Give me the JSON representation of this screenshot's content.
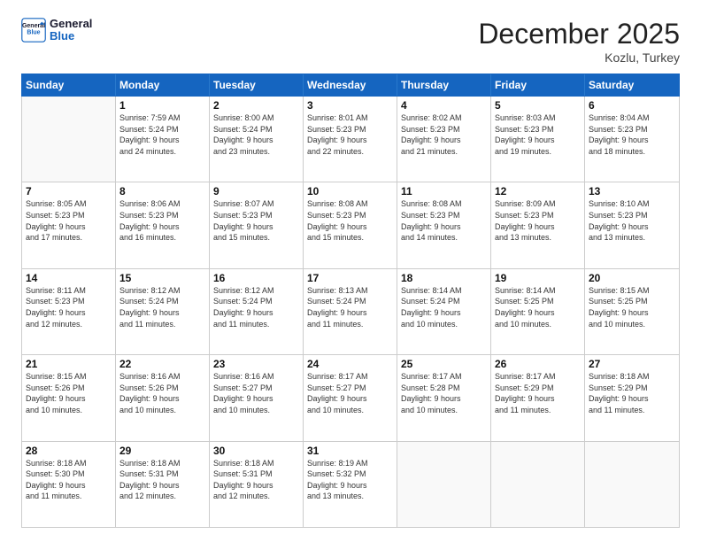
{
  "header": {
    "logo_line1": "General",
    "logo_line2": "Blue",
    "month": "December 2025",
    "location": "Kozlu, Turkey"
  },
  "days_of_week": [
    "Sunday",
    "Monday",
    "Tuesday",
    "Wednesday",
    "Thursday",
    "Friday",
    "Saturday"
  ],
  "weeks": [
    [
      {
        "day": "",
        "info": ""
      },
      {
        "day": "1",
        "info": "Sunrise: 7:59 AM\nSunset: 5:24 PM\nDaylight: 9 hours\nand 24 minutes."
      },
      {
        "day": "2",
        "info": "Sunrise: 8:00 AM\nSunset: 5:24 PM\nDaylight: 9 hours\nand 23 minutes."
      },
      {
        "day": "3",
        "info": "Sunrise: 8:01 AM\nSunset: 5:23 PM\nDaylight: 9 hours\nand 22 minutes."
      },
      {
        "day": "4",
        "info": "Sunrise: 8:02 AM\nSunset: 5:23 PM\nDaylight: 9 hours\nand 21 minutes."
      },
      {
        "day": "5",
        "info": "Sunrise: 8:03 AM\nSunset: 5:23 PM\nDaylight: 9 hours\nand 19 minutes."
      },
      {
        "day": "6",
        "info": "Sunrise: 8:04 AM\nSunset: 5:23 PM\nDaylight: 9 hours\nand 18 minutes."
      }
    ],
    [
      {
        "day": "7",
        "info": "Sunrise: 8:05 AM\nSunset: 5:23 PM\nDaylight: 9 hours\nand 17 minutes."
      },
      {
        "day": "8",
        "info": "Sunrise: 8:06 AM\nSunset: 5:23 PM\nDaylight: 9 hours\nand 16 minutes."
      },
      {
        "day": "9",
        "info": "Sunrise: 8:07 AM\nSunset: 5:23 PM\nDaylight: 9 hours\nand 15 minutes."
      },
      {
        "day": "10",
        "info": "Sunrise: 8:08 AM\nSunset: 5:23 PM\nDaylight: 9 hours\nand 15 minutes."
      },
      {
        "day": "11",
        "info": "Sunrise: 8:08 AM\nSunset: 5:23 PM\nDaylight: 9 hours\nand 14 minutes."
      },
      {
        "day": "12",
        "info": "Sunrise: 8:09 AM\nSunset: 5:23 PM\nDaylight: 9 hours\nand 13 minutes."
      },
      {
        "day": "13",
        "info": "Sunrise: 8:10 AM\nSunset: 5:23 PM\nDaylight: 9 hours\nand 13 minutes."
      }
    ],
    [
      {
        "day": "14",
        "info": "Sunrise: 8:11 AM\nSunset: 5:23 PM\nDaylight: 9 hours\nand 12 minutes."
      },
      {
        "day": "15",
        "info": "Sunrise: 8:12 AM\nSunset: 5:24 PM\nDaylight: 9 hours\nand 11 minutes."
      },
      {
        "day": "16",
        "info": "Sunrise: 8:12 AM\nSunset: 5:24 PM\nDaylight: 9 hours\nand 11 minutes."
      },
      {
        "day": "17",
        "info": "Sunrise: 8:13 AM\nSunset: 5:24 PM\nDaylight: 9 hours\nand 11 minutes."
      },
      {
        "day": "18",
        "info": "Sunrise: 8:14 AM\nSunset: 5:24 PM\nDaylight: 9 hours\nand 10 minutes."
      },
      {
        "day": "19",
        "info": "Sunrise: 8:14 AM\nSunset: 5:25 PM\nDaylight: 9 hours\nand 10 minutes."
      },
      {
        "day": "20",
        "info": "Sunrise: 8:15 AM\nSunset: 5:25 PM\nDaylight: 9 hours\nand 10 minutes."
      }
    ],
    [
      {
        "day": "21",
        "info": "Sunrise: 8:15 AM\nSunset: 5:26 PM\nDaylight: 9 hours\nand 10 minutes."
      },
      {
        "day": "22",
        "info": "Sunrise: 8:16 AM\nSunset: 5:26 PM\nDaylight: 9 hours\nand 10 minutes."
      },
      {
        "day": "23",
        "info": "Sunrise: 8:16 AM\nSunset: 5:27 PM\nDaylight: 9 hours\nand 10 minutes."
      },
      {
        "day": "24",
        "info": "Sunrise: 8:17 AM\nSunset: 5:27 PM\nDaylight: 9 hours\nand 10 minutes."
      },
      {
        "day": "25",
        "info": "Sunrise: 8:17 AM\nSunset: 5:28 PM\nDaylight: 9 hours\nand 10 minutes."
      },
      {
        "day": "26",
        "info": "Sunrise: 8:17 AM\nSunset: 5:29 PM\nDaylight: 9 hours\nand 11 minutes."
      },
      {
        "day": "27",
        "info": "Sunrise: 8:18 AM\nSunset: 5:29 PM\nDaylight: 9 hours\nand 11 minutes."
      }
    ],
    [
      {
        "day": "28",
        "info": "Sunrise: 8:18 AM\nSunset: 5:30 PM\nDaylight: 9 hours\nand 11 minutes."
      },
      {
        "day": "29",
        "info": "Sunrise: 8:18 AM\nSunset: 5:31 PM\nDaylight: 9 hours\nand 12 minutes."
      },
      {
        "day": "30",
        "info": "Sunrise: 8:18 AM\nSunset: 5:31 PM\nDaylight: 9 hours\nand 12 minutes."
      },
      {
        "day": "31",
        "info": "Sunrise: 8:19 AM\nSunset: 5:32 PM\nDaylight: 9 hours\nand 13 minutes."
      },
      {
        "day": "",
        "info": ""
      },
      {
        "day": "",
        "info": ""
      },
      {
        "day": "",
        "info": ""
      }
    ]
  ]
}
